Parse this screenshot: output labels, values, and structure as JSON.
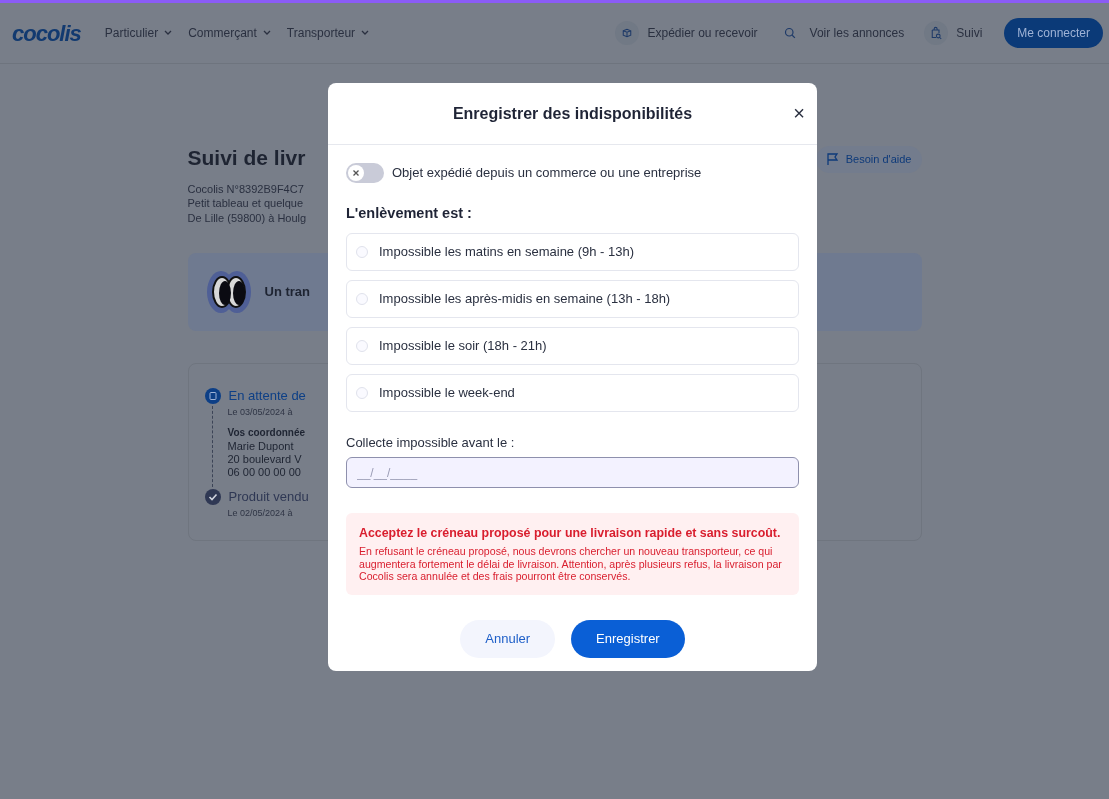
{
  "header": {
    "logo": "cocolis",
    "menus": [
      {
        "label": "Particulier"
      },
      {
        "label": "Commerçant"
      },
      {
        "label": "Transporteur"
      }
    ],
    "actions": [
      {
        "kind": "box",
        "label": "Expédier ou recevoir"
      },
      {
        "kind": "search",
        "label": "Voir les annonces"
      },
      {
        "kind": "track",
        "label": "Suivi"
      }
    ],
    "login": "Me connecter"
  },
  "page": {
    "title": "Suivi de livr",
    "info_lines": [
      "Cocolis N°8392B9F4C7",
      "Petit tableau et quelque",
      "De Lille (59800) à Houlg"
    ],
    "help_button": "Besoin d'aide",
    "banner_text": "Un tran",
    "timeline": [
      {
        "active": true,
        "title": "En attente de",
        "date": "Le 03/05/2024 à",
        "details_heading": "Vos coordonnée",
        "details_lines": [
          "Marie Dupont",
          "20 boulevard V",
          "06 00 00 00 00"
        ]
      },
      {
        "active": false,
        "title": "Produit vendu",
        "date": "Le 02/05/2024 à"
      }
    ]
  },
  "modal": {
    "title": "Enregistrer des indisponibilités",
    "close": "×",
    "toggle": {
      "label": "Objet expédié depuis un commerce ou une entreprise",
      "on": false
    },
    "section_label": "L'enlèvement est :",
    "options": [
      {
        "label": "Impossible les matins en semaine (9h - 13h)",
        "selected": false
      },
      {
        "label": "Impossible les après-midis en semaine (13h - 18h)",
        "selected": false
      },
      {
        "label": "Impossible le soir (18h - 21h)",
        "selected": false
      },
      {
        "label": "Impossible le week-end",
        "selected": false
      }
    ],
    "date_field": {
      "label": "Collecte impossible avant le :",
      "placeholder": "__/__/____"
    },
    "alert": {
      "title": "Acceptez le créneau proposé pour une livraison rapide et sans surcoût.",
      "text": "En refusant le créneau proposé, nous devrons chercher un nouveau transporteur, ce qui augmentera fortement le délai de livraison. Attention, après plusieurs refus, la livraison par Cocolis sera annulée et des frais pourront être conservés."
    },
    "buttons": [
      {
        "kind": "cancel",
        "label": "Annuler"
      },
      {
        "kind": "submit",
        "label": "Enregistrer"
      }
    ]
  }
}
